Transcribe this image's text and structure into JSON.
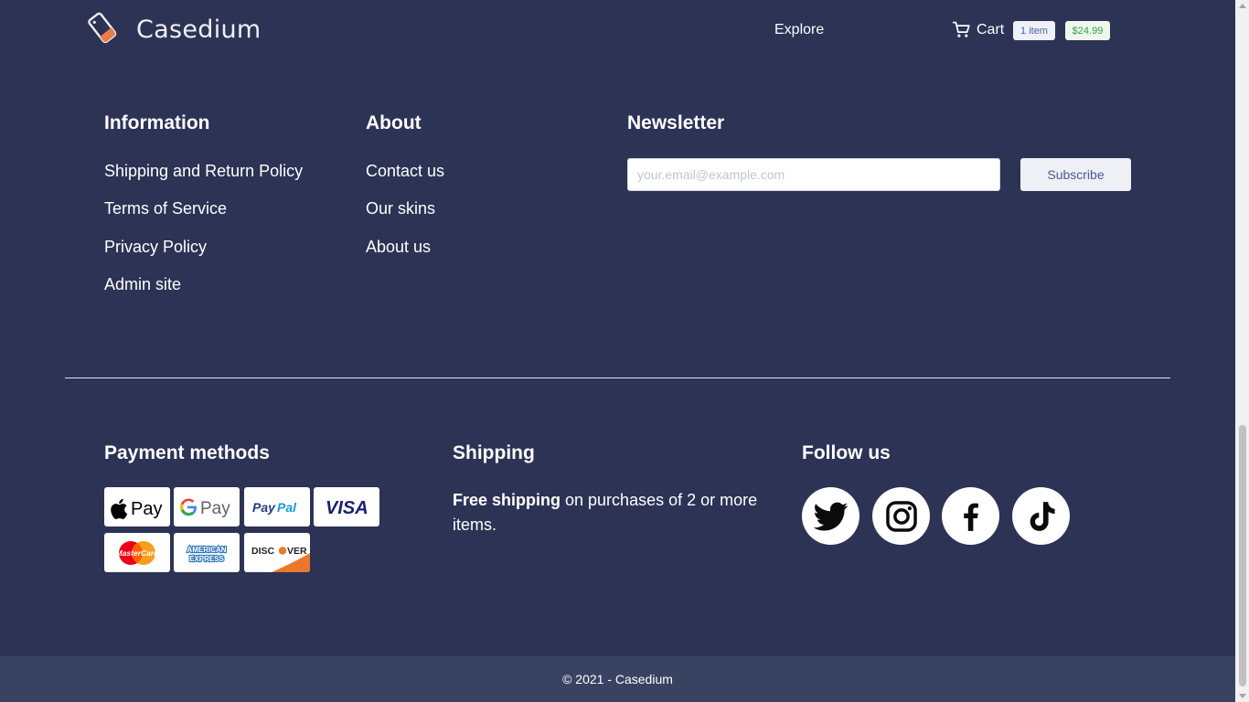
{
  "brand": {
    "name": "Casedium"
  },
  "nav": {
    "explore": "Explore",
    "cart_label": "Cart",
    "cart_items_badge": "1 item",
    "cart_total_badge": "$24.99"
  },
  "information": {
    "title": "Information",
    "links": [
      "Shipping and Return Policy",
      "Terms of Service",
      "Privacy Policy",
      "Admin site"
    ]
  },
  "about": {
    "title": "About",
    "links": [
      "Contact us",
      "Our skins",
      "About us"
    ]
  },
  "newsletter": {
    "title": "Newsletter",
    "email_placeholder": "your.email@example.com",
    "email_value": "",
    "subscribe_label": "Subscribe"
  },
  "payment": {
    "title": "Payment methods",
    "methods": [
      "Apple Pay",
      "Google Pay",
      "PayPal",
      "Visa",
      "MasterCard",
      "American Express",
      "Discover"
    ]
  },
  "shipping": {
    "title": "Shipping",
    "bold_text": "Free shipping",
    "text": " on purchases of 2 or more items."
  },
  "follow": {
    "title": "Follow us",
    "networks": [
      "twitter-icon",
      "instagram-icon",
      "facebook-icon",
      "tiktok-icon"
    ]
  },
  "footer": {
    "copyright": "© 2021 - Casedium"
  },
  "colors": {
    "background": "#2c3354",
    "footer_bar": "#3a4262",
    "price_badge_text": "#2f9e48",
    "items_badge_text": "#4a5fa0",
    "logo_accent": "#f07a4a"
  }
}
